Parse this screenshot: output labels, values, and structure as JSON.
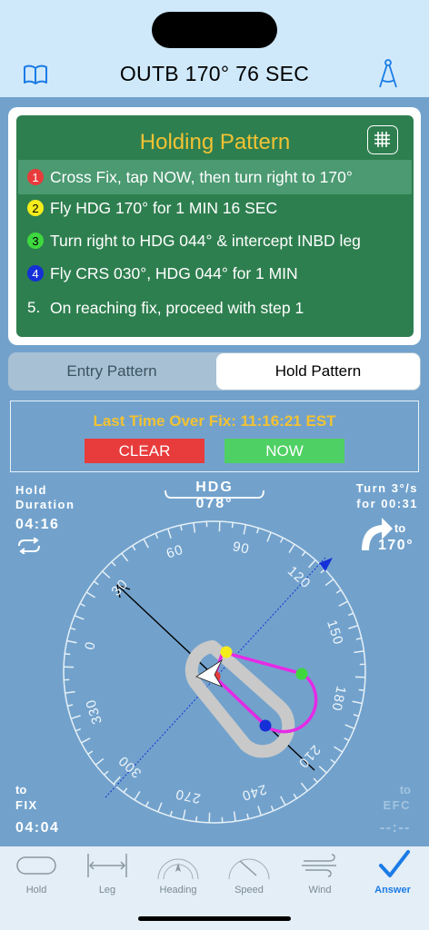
{
  "header": {
    "title": "OUTB 170°  76 SEC"
  },
  "instructions": {
    "title": "Holding Pattern",
    "steps": [
      {
        "num": "1",
        "text": "Cross Fix, tap NOW, then turn right to 170°",
        "color": "#e83b3c"
      },
      {
        "num": "2",
        "text": "Fly HDG 170° for 1 MIN 16 SEC",
        "color": "#f5ec1c"
      },
      {
        "num": "3",
        "text": "Turn right to HDG 044° & intercept INBD leg",
        "color": "#3ed83e"
      },
      {
        "num": "4",
        "text": "Fly CRS 030°, HDG 044° for 1 MIN",
        "color": "#1430d6"
      },
      {
        "num": "5.",
        "text": "On reaching fix, proceed with step 1",
        "color": ""
      }
    ]
  },
  "segmented": {
    "entry_label": "Entry Pattern",
    "hold_label": "Hold Pattern",
    "selected": "Hold Pattern"
  },
  "timer": {
    "last_time_label": "Last Time Over Fix:  11:16:21 EST",
    "clear_label": "CLEAR",
    "now_label": "NOW"
  },
  "instrument": {
    "hdg_label": "HDG 078°",
    "hold_duration_title_1": "Hold",
    "hold_duration_title_2": "Duration",
    "hold_duration_value": "04:16",
    "turn_line_1": "Turn 3°/s",
    "turn_line_2": "for 00:31",
    "turn_to_label": "to",
    "turn_to_value": "170°",
    "to_fix_label_1": "to",
    "to_fix_label_2": "FIX",
    "to_fix_value": "04:04",
    "efc_label_1": "to",
    "efc_label_2": "EFC",
    "efc_value": "--:--",
    "dial_labels": [
      "60",
      "90",
      "120",
      "150",
      "180",
      "210",
      "240",
      "270",
      "300",
      "330",
      "0",
      "30"
    ]
  },
  "tabs": [
    {
      "label": "Hold",
      "icon": "hold-icon",
      "active": false
    },
    {
      "label": "Leg",
      "icon": "leg-icon",
      "active": false
    },
    {
      "label": "Heading",
      "icon": "heading-icon",
      "active": false
    },
    {
      "label": "Speed",
      "icon": "speed-icon",
      "active": false
    },
    {
      "label": "Wind",
      "icon": "wind-icon",
      "active": false
    },
    {
      "label": "Answer",
      "icon": "checkmark-icon",
      "active": true
    }
  ],
  "colors": {
    "accent": "#1b7be6",
    "panel_green": "#2e7f4f",
    "title_yellow": "#f2c233",
    "holding_track": "#e62ae6"
  }
}
